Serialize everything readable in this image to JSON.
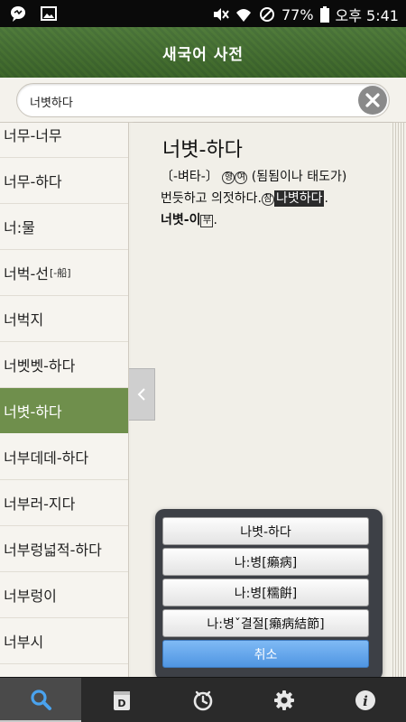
{
  "status_bar": {
    "battery_text": "77%",
    "time_text": "오후 5:41"
  },
  "app": {
    "title": "새국어 사전"
  },
  "search": {
    "value": "너볏하다"
  },
  "word_list": {
    "items": [
      {
        "label": "너무-너무",
        "hanja": ""
      },
      {
        "label": "너무-하다",
        "hanja": ""
      },
      {
        "label": "너:물",
        "hanja": ""
      },
      {
        "label": "너벅-선",
        "hanja": "[-船]"
      },
      {
        "label": "너벅지",
        "hanja": ""
      },
      {
        "label": "너벳벳-하다",
        "hanja": ""
      },
      {
        "label": "너볏-하다",
        "hanja": ""
      },
      {
        "label": "너부데데-하다",
        "hanja": ""
      },
      {
        "label": "너부러-지다",
        "hanja": ""
      },
      {
        "label": "너부렁넓적-하다",
        "hanja": ""
      },
      {
        "label": "너부렁이",
        "hanja": ""
      },
      {
        "label": "너부시",
        "hanja": ""
      }
    ],
    "selected_index": 6
  },
  "entry": {
    "headword": "너볏-하다",
    "line1_prefix": "〔-벼타-〕",
    "pos_mark": "형",
    "conj_mark": "여",
    "definition_a": "(됨됨이나 태도가)",
    "definition_b": "번듯하고 의젓하다.",
    "ref_mark": "참",
    "ref_word": "나볏하다",
    "period": ".",
    "derived_word": "너볏-이",
    "adverb_mark": "부",
    "end_period": "."
  },
  "popup": {
    "options": [
      "나볏-하다",
      "나:병[癩病]",
      "나:병[糯餠]",
      "나:병ˇ결절[癩病結節]"
    ],
    "cancel_label": "취소"
  },
  "bottom_nav": {
    "items": [
      "search-icon",
      "dictionary-icon",
      "history-clock-icon",
      "settings-gear-icon",
      "info-icon"
    ],
    "active_index": 0
  },
  "colors": {
    "title_bar": "#3d6a2d",
    "selected_row": "#6f8f4c",
    "popup_bg": "#3d4046",
    "cancel_button": "#5a9fe8"
  }
}
